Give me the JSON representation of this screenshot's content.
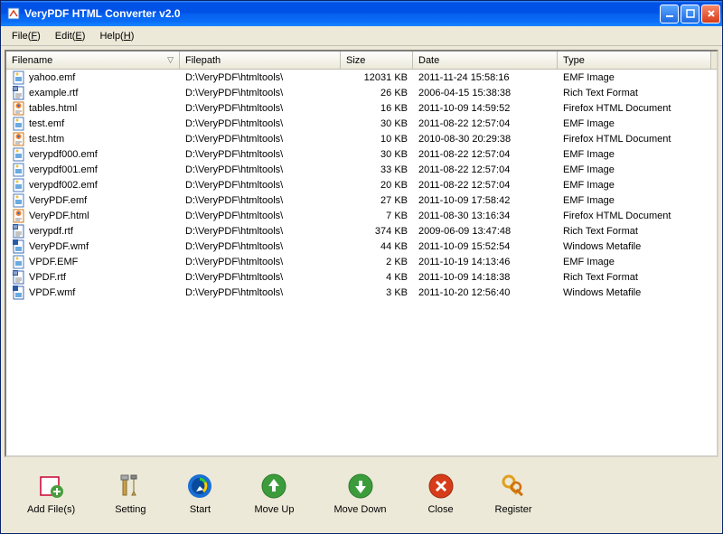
{
  "window": {
    "title": "VeryPDF HTML Converter v2.0"
  },
  "menubar": {
    "file": "File(F)",
    "edit": "Edit(E)",
    "help": "Help(H)"
  },
  "columns": {
    "filename": "Filename",
    "filepath": "Filepath",
    "size": "Size",
    "date": "Date",
    "type": "Type"
  },
  "files": [
    {
      "icon": "emf",
      "name": "yahoo.emf",
      "path": "D:\\VeryPDF\\htmltools\\",
      "size": "12031 KB",
      "date": "2011-11-24 15:58:16",
      "type": "EMF Image"
    },
    {
      "icon": "rtf",
      "name": "example.rtf",
      "path": "D:\\VeryPDF\\htmltools\\",
      "size": "26 KB",
      "date": "2006-04-15 15:38:38",
      "type": "Rich Text Format"
    },
    {
      "icon": "html",
      "name": "tables.html",
      "path": "D:\\VeryPDF\\htmltools\\",
      "size": "16 KB",
      "date": "2011-10-09 14:59:52",
      "type": "Firefox HTML Document"
    },
    {
      "icon": "emf",
      "name": "test.emf",
      "path": "D:\\VeryPDF\\htmltools\\",
      "size": "30 KB",
      "date": "2011-08-22 12:57:04",
      "type": "EMF Image"
    },
    {
      "icon": "html",
      "name": "test.htm",
      "path": "D:\\VeryPDF\\htmltools\\",
      "size": "10 KB",
      "date": "2010-08-30 20:29:38",
      "type": "Firefox HTML Document"
    },
    {
      "icon": "emf",
      "name": "verypdf000.emf",
      "path": "D:\\VeryPDF\\htmltools\\",
      "size": "30 KB",
      "date": "2011-08-22 12:57:04",
      "type": "EMF Image"
    },
    {
      "icon": "emf",
      "name": "verypdf001.emf",
      "path": "D:\\VeryPDF\\htmltools\\",
      "size": "33 KB",
      "date": "2011-08-22 12:57:04",
      "type": "EMF Image"
    },
    {
      "icon": "emf",
      "name": "verypdf002.emf",
      "path": "D:\\VeryPDF\\htmltools\\",
      "size": "20 KB",
      "date": "2011-08-22 12:57:04",
      "type": "EMF Image"
    },
    {
      "icon": "emf",
      "name": "VeryPDF.emf",
      "path": "D:\\VeryPDF\\htmltools\\",
      "size": "27 KB",
      "date": "2011-10-09 17:58:42",
      "type": "EMF Image"
    },
    {
      "icon": "html",
      "name": "VeryPDF.html",
      "path": "D:\\VeryPDF\\htmltools\\",
      "size": "7 KB",
      "date": "2011-08-30 13:16:34",
      "type": "Firefox HTML Document"
    },
    {
      "icon": "rtf",
      "name": "verypdf.rtf",
      "path": "D:\\VeryPDF\\htmltools\\",
      "size": "374 KB",
      "date": "2009-06-09 13:47:48",
      "type": "Rich Text Format"
    },
    {
      "icon": "wmf",
      "name": "VeryPDF.wmf",
      "path": "D:\\VeryPDF\\htmltools\\",
      "size": "44 KB",
      "date": "2011-10-09 15:52:54",
      "type": "Windows Metafile"
    },
    {
      "icon": "emf",
      "name": "VPDF.EMF",
      "path": "D:\\VeryPDF\\htmltools\\",
      "size": "2 KB",
      "date": "2011-10-19 14:13:46",
      "type": "EMF Image"
    },
    {
      "icon": "rtf",
      "name": "VPDF.rtf",
      "path": "D:\\VeryPDF\\htmltools\\",
      "size": "4 KB",
      "date": "2011-10-09 14:18:38",
      "type": "Rich Text Format"
    },
    {
      "icon": "wmf",
      "name": "VPDF.wmf",
      "path": "D:\\VeryPDF\\htmltools\\",
      "size": "3 KB",
      "date": "2011-10-20 12:56:40",
      "type": "Windows Metafile"
    }
  ],
  "toolbar": {
    "addfiles": "Add File(s)",
    "setting": "Setting",
    "start": "Start",
    "moveup": "Move Up",
    "movedown": "Move Down",
    "close": "Close",
    "register": "Register"
  }
}
